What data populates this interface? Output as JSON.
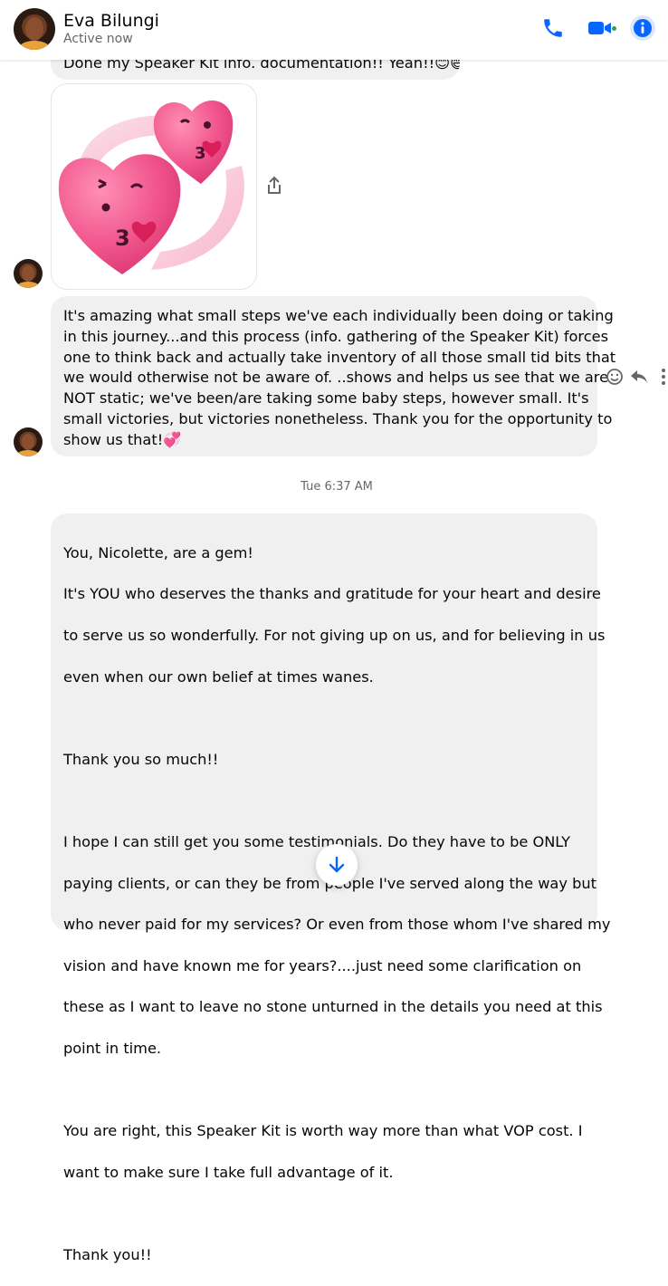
{
  "header": {
    "name": "Eva Bilungi",
    "status": "Active now",
    "icons": [
      "phone-icon",
      "video-icon",
      "info-icon"
    ],
    "accent_color": "#0866ff",
    "active_color": "#31a24c"
  },
  "messages": {
    "top_partial": "Done my Speaker Kit info. documentation!! Yeah!!😊😄",
    "sticker": "pink-kissing-hearts-sticker",
    "long_message": {
      "lines": [
        "It's amazing what small steps we've each individually been doing or taking",
        "in this journey...and this process (info. gathering of the Speaker Kit) forces",
        "one to think back and actually take inventory of all those small tid bits that",
        "we would otherwise not be aware of. ..shows and helps us see that we are",
        "NOT static; we've been/are taking some baby steps, however small. It's",
        "small victories, but victories nonetheless. Thank you for the opportunity to",
        "show us that!💞"
      ]
    },
    "timestamp": "Tue 6:37 AM",
    "last_message": {
      "lines": [
        "You, Nicolette, are a gem!",
        "It's YOU who deserves the thanks and gratitude for your heart and desire",
        "to serve us so wonderfully. For not giving up on us, and for believing in us",
        "even when our own belief at times wanes.",
        "",
        "Thank you so much!!",
        "",
        "I hope I can still get you some testimonials. Do they have to be ONLY",
        "paying clients, or can they be from people I've served along the way but",
        "who never paid for my services? Or even from those whom I've shared my",
        "vision and have known me for years?....just need some clarification on",
        "these as I want to leave no stone unturned in the details you need at this",
        "point in time.",
        "",
        "You are right, this Speaker Kit is worth way more than what VOP cost. I",
        "want to make sure I take full advantage of it.",
        "",
        "Thank you!!"
      ]
    }
  },
  "controls": {
    "scroll_down": "arrow-down-icon",
    "message_actions": [
      "react-smile-icon",
      "reply-icon",
      "more-options-icon"
    ]
  }
}
